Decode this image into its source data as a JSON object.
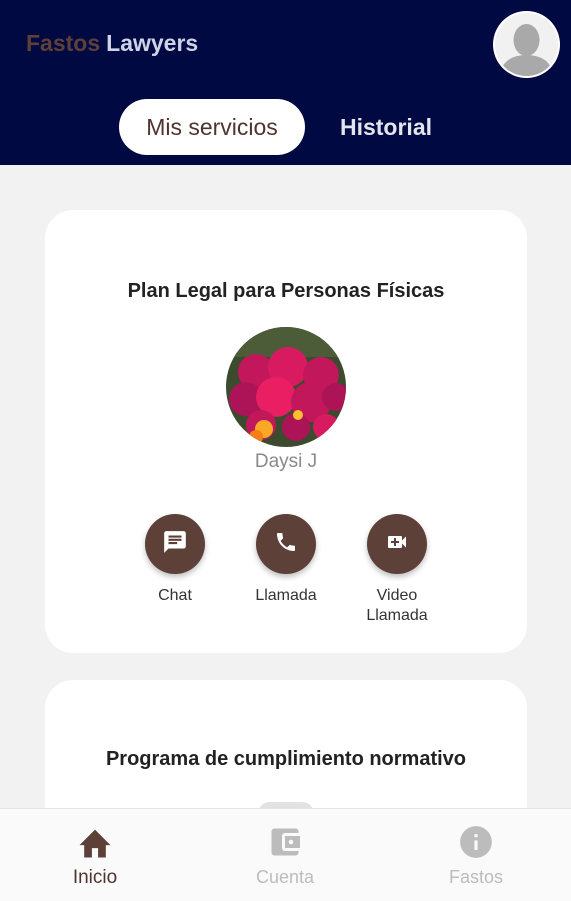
{
  "header": {
    "brand_part1": "Fastos",
    "brand_part2": "Lawyers",
    "avatar_icon": "user-avatar-icon",
    "tabs": [
      {
        "label": "Mis servicios",
        "active": true
      },
      {
        "label": "Historial",
        "active": false
      }
    ]
  },
  "cards": [
    {
      "title": "Plan Legal para Personas Físicas",
      "lawyer_name": "Daysi J",
      "actions": [
        {
          "label": "Chat",
          "icon": "chat-icon"
        },
        {
          "label": "Llamada",
          "icon": "phone-icon"
        },
        {
          "label": "Video\nLlamada",
          "icon": "video-call-icon"
        }
      ]
    },
    {
      "title": "Programa de cumplimiento normativo"
    }
  ],
  "bottom_nav": [
    {
      "label": "Inicio",
      "icon": "home-icon",
      "active": true
    },
    {
      "label": "Cuenta",
      "icon": "wallet-icon",
      "active": false
    },
    {
      "label": "Fastos",
      "icon": "info-icon",
      "active": false
    }
  ],
  "colors": {
    "header_bg": "#010942",
    "accent_brown": "#5d4037",
    "background": "#f2f2f2",
    "inactive_nav": "#bcbcbc"
  }
}
